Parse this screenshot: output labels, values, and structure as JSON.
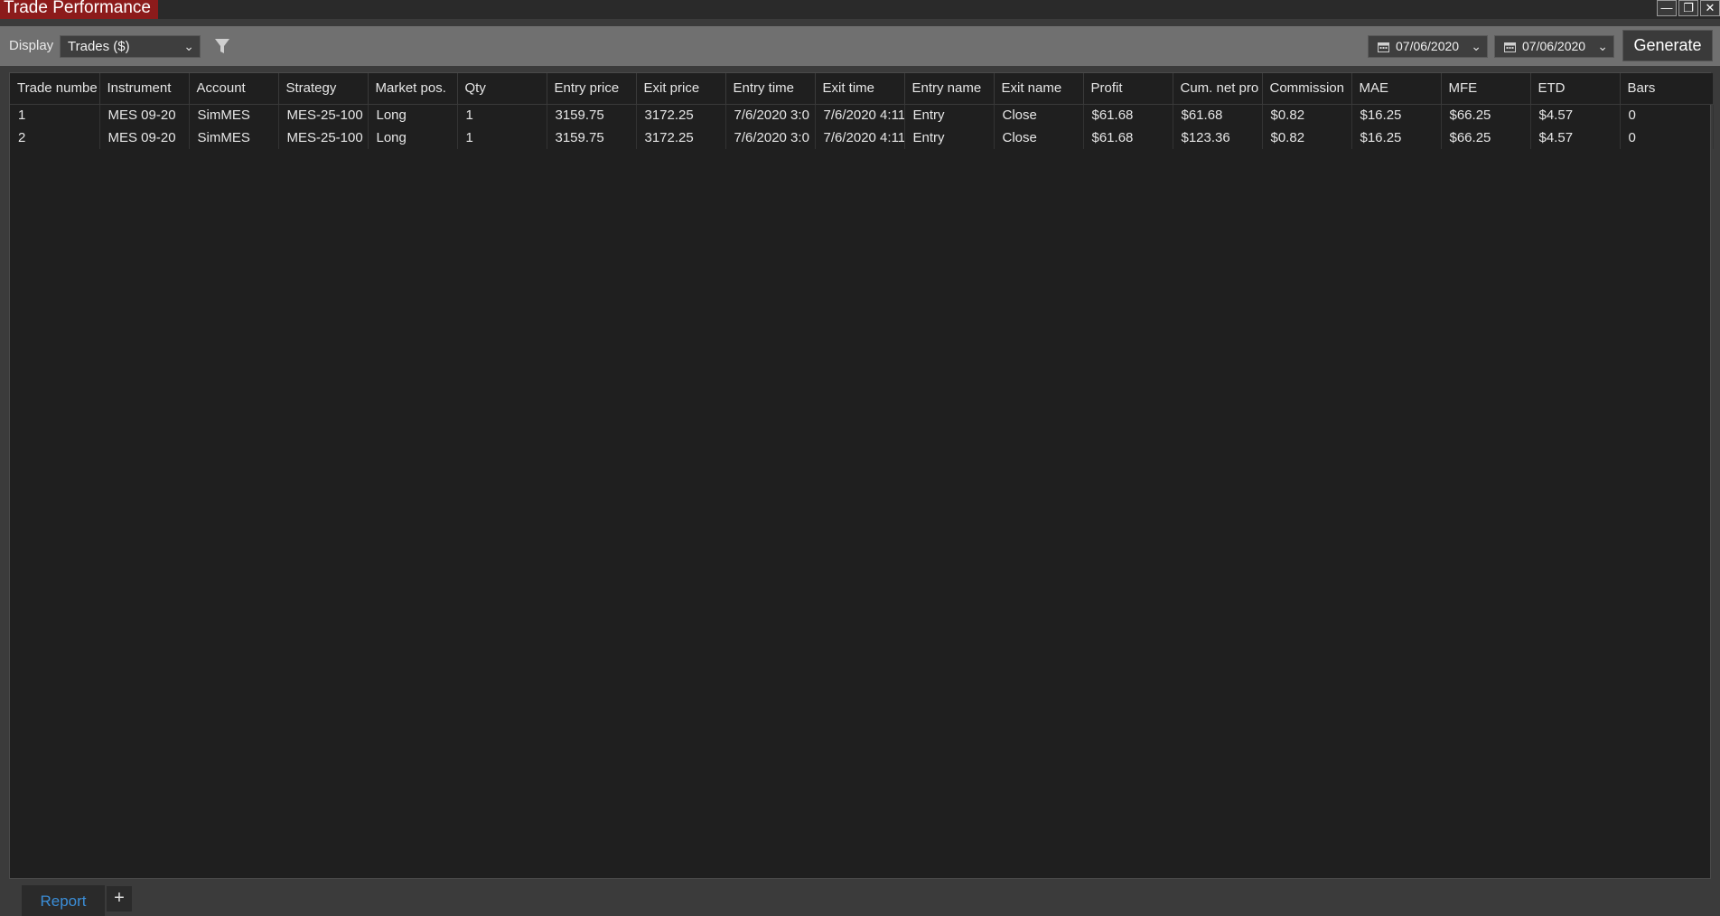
{
  "window": {
    "title": "Trade Performance",
    "controls": [
      "minimize-icon",
      "restore-icon",
      "close-icon"
    ]
  },
  "toolbar": {
    "display_label": "Display",
    "display_value": "Trades ($)",
    "from_date": "07/06/2020",
    "to_date": "07/06/2020",
    "generate_label": "Generate"
  },
  "table": {
    "columns": [
      "Trade numbe",
      "Instrument",
      "Account",
      "Strategy",
      "Market pos.",
      "Qty",
      "Entry price",
      "Exit price",
      "Entry time",
      "Exit time",
      "Entry name",
      "Exit name",
      "Profit",
      "Cum. net pro",
      "Commission",
      "MAE",
      "MFE",
      "ETD",
      "Bars"
    ],
    "rows": [
      [
        "1",
        "MES 09-20",
        "SimMES",
        "MES-25-100",
        "Long",
        "1",
        "3159.75",
        "3172.25",
        "7/6/2020 3:0",
        "7/6/2020 4:11",
        "Entry",
        "Close",
        "$61.68",
        "$61.68",
        "$0.82",
        "$16.25",
        "$66.25",
        "$4.57",
        "0"
      ],
      [
        "2",
        "MES 09-20",
        "SimMES",
        "MES-25-100",
        "Long",
        "1",
        "3159.75",
        "3172.25",
        "7/6/2020 3:0",
        "7/6/2020 4:11",
        "Entry",
        "Close",
        "$61.68",
        "$123.36",
        "$0.82",
        "$16.25",
        "$66.25",
        "$4.57",
        "0"
      ]
    ]
  },
  "tabs": {
    "active": "Report",
    "add_label": "+"
  },
  "colors": {
    "title_accent": "#8c1b1b",
    "active_tab_text": "#3b8ed8",
    "grid_bg": "#1f1f1f"
  }
}
